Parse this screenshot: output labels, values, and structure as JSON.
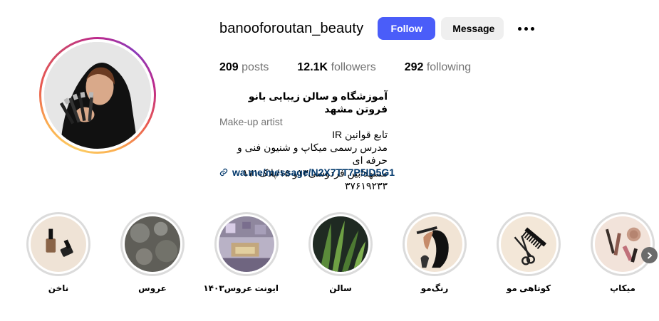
{
  "profile": {
    "username": "banooforoutan_beauty",
    "follow_label": "Follow",
    "message_label": "Message",
    "more_icon": "more-horizontal-icon"
  },
  "stats": {
    "posts_count": "209",
    "posts_label": "posts",
    "followers_count": "12.1K",
    "followers_label": "followers",
    "following_count": "292",
    "following_label": "following"
  },
  "bio": {
    "name": "آموزشگاه و سالن زیبایی بانو فروتن مشهد",
    "category": "Make-up artist",
    "lines": [
      "تابع قوانین IR",
      "مدرس رسمی میکاپ و شنیون فنی و حرفه ای",
      "مشهد/بین فردوسی۱۳و ۱۵/پلاک۱۷۱",
      "۳۷۶۱۹۲۳۳"
    ],
    "link": "wa.me/message/N2X7TT7P5ID5G1"
  },
  "highlights": [
    {
      "label": "ناخن",
      "icon": "nail-polish-icon"
    },
    {
      "label": "عروس",
      "icon": "bokeh-photo"
    },
    {
      "label": "ایونت عروس۱۴۰۳",
      "icon": "event-photo"
    },
    {
      "label": "سالن",
      "icon": "salon-plant-photo"
    },
    {
      "label": "رنگ‌مو",
      "icon": "hair-dye-icon"
    },
    {
      "label": "کوتاهی مو",
      "icon": "comb-scissors-icon"
    },
    {
      "label": "میکاپ",
      "icon": "makeup-icon"
    }
  ],
  "colors": {
    "follow_button": "#4a5df9",
    "message_button": "#efefef",
    "link": "#00376b",
    "muted_text": "#737373"
  }
}
